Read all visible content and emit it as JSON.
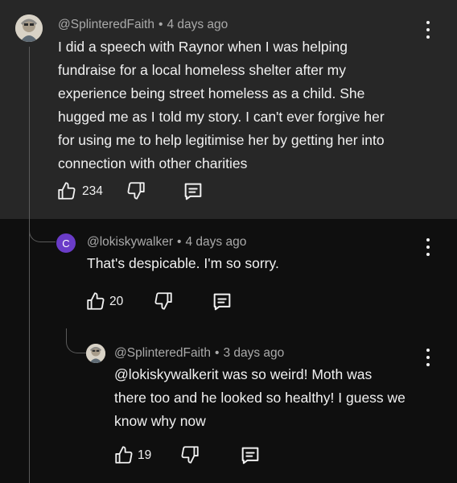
{
  "comments": [
    {
      "handle": "@SplinteredFaith",
      "separator": "•",
      "time": "4 days ago",
      "lines": [
        "I did a speech with Raynor when I was helping",
        "fundraise for a local homeless shelter after my",
        "experience being street homeless as a child. She",
        "hugged me as I told my story. I can't ever forgive her",
        "for using me to help legitimise her by getting her into",
        "connection with other charities"
      ],
      "likes": "234"
    },
    {
      "avatar_letter": "C",
      "handle": "@lokiskywalker",
      "separator": "•",
      "time": "4 days ago",
      "lines": [
        "That's despicable. I'm so sorry."
      ],
      "likes": "20"
    },
    {
      "handle": "@SplinteredFaith",
      "separator": "•",
      "time": "3 days ago",
      "lines": [
        "@lokiskywalkerit was so weird! Moth was",
        "there too and he looked so healthy! I guess we",
        "know why now"
      ],
      "likes": "19"
    }
  ],
  "colors": {
    "top_background": "#272727",
    "page_background": "#0f0f0f",
    "avatar_purple": "#6a3cc8",
    "muted_text": "#aaaaaa"
  },
  "icons": [
    "thumbs-up-icon",
    "thumbs-down-icon",
    "reply-icon",
    "more-vert-icon"
  ]
}
